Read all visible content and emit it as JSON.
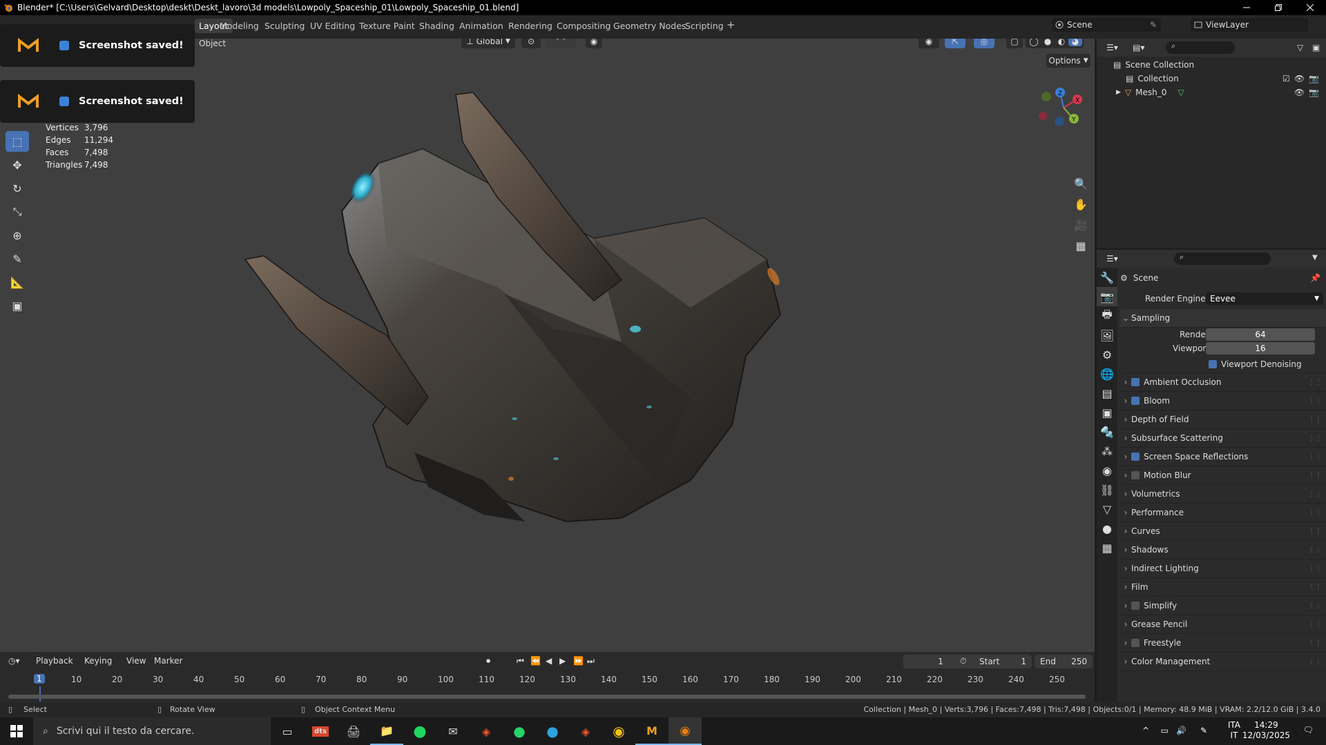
{
  "window": {
    "title": "Blender* [C:\\Users\\Gelvard\\Desktop\\deskt\\Deskt_lavoro\\3d models\\Lowpoly_Spaceship_01\\Lowpoly_Spaceship_01.blend]"
  },
  "workspaces": [
    "Layout",
    "Modeling",
    "Sculpting",
    "UV Editing",
    "Texture Paint",
    "Shading",
    "Animation",
    "Rendering",
    "Compositing",
    "Geometry Nodes",
    "Scripting"
  ],
  "topbar": {
    "scene": "Scene",
    "view_layer": "ViewLayer"
  },
  "viewport": {
    "mode_label": "Object",
    "transform": "Global",
    "options_label": "Options"
  },
  "stats": [
    {
      "k": "Vertices",
      "v": "3,796"
    },
    {
      "k": "Edges",
      "v": "11,294"
    },
    {
      "k": "Faces",
      "v": "7,498"
    },
    {
      "k": "Triangles",
      "v": "7,498"
    }
  ],
  "toasts": [
    {
      "msg": "Screenshot saved!"
    },
    {
      "msg": "Screenshot saved!"
    }
  ],
  "timeline": {
    "menus": [
      "Playback",
      "Keying",
      "View",
      "Marker"
    ],
    "current_frame": "1",
    "start_label": "Start",
    "start": "1",
    "end_label": "End",
    "end": "250",
    "ticks": [
      "1",
      "10",
      "20",
      "30",
      "40",
      "50",
      "60",
      "70",
      "80",
      "90",
      "100",
      "110",
      "120",
      "130",
      "140",
      "150",
      "160",
      "170",
      "180",
      "190",
      "200",
      "210",
      "220",
      "230",
      "240",
      "250"
    ]
  },
  "outliner": {
    "root": "Scene Collection",
    "collection": "Collection",
    "object": "Mesh_0"
  },
  "properties": {
    "scene_label": "Scene",
    "render_engine_label": "Render Engine",
    "render_engine": "Eevee",
    "sampling": {
      "title": "Sampling",
      "render_label": "Render",
      "render": "64",
      "viewport_label": "Viewport",
      "viewport": "16",
      "denoise": "Viewport Denoising"
    },
    "panels": [
      {
        "label": "Ambient Occlusion",
        "checkbox": true,
        "checked": true
      },
      {
        "label": "Bloom",
        "checkbox": true,
        "checked": true
      },
      {
        "label": "Depth of Field",
        "checkbox": false,
        "checked": false
      },
      {
        "label": "Subsurface Scattering",
        "checkbox": false,
        "checked": false
      },
      {
        "label": "Screen Space Reflections",
        "checkbox": true,
        "checked": true
      },
      {
        "label": "Motion Blur",
        "checkbox": true,
        "checked": false
      },
      {
        "label": "Volumetrics",
        "checkbox": false,
        "checked": false
      },
      {
        "label": "Performance",
        "checkbox": false,
        "checked": false
      },
      {
        "label": "Curves",
        "checkbox": false,
        "checked": false
      },
      {
        "label": "Shadows",
        "checkbox": false,
        "checked": false
      },
      {
        "label": "Indirect Lighting",
        "checkbox": false,
        "checked": false
      },
      {
        "label": "Film",
        "checkbox": false,
        "checked": false
      },
      {
        "label": "Simplify",
        "checkbox": true,
        "checked": false
      },
      {
        "label": "Grease Pencil",
        "checkbox": false,
        "checked": false
      },
      {
        "label": "Freestyle",
        "checkbox": true,
        "checked": false
      },
      {
        "label": "Color Management",
        "checkbox": false,
        "checked": false
      }
    ]
  },
  "statusbar": {
    "select": "Select",
    "rotate": "Rotate View",
    "context": "Object Context Menu",
    "info": "Collection | Mesh_0 | Verts:3,796 | Faces:7,498 | Tris:7,498 | Objects:0/1 | Memory: 48.9 MiB | VRAM: 2.2/12.0 GiB | 3.4.0"
  },
  "taskbar": {
    "search_placeholder": "Scrivi qui il testo da cercare.",
    "lang1": "ITA",
    "lang2": "IT",
    "time": "14:29",
    "date": "12/03/2025"
  },
  "colors": {
    "accent": "#4772b3",
    "viewport_bg": "#3f3f3f",
    "panel_bg": "#2b2b2b"
  }
}
